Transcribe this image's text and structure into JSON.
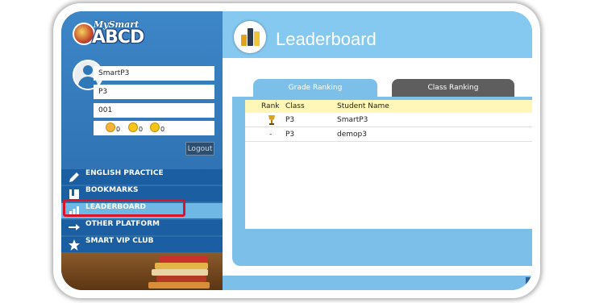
{
  "brand": {
    "top": "MySmart",
    "main": "ABCD"
  },
  "user": {
    "name": "SmartP3",
    "class": "P3",
    "number": "001"
  },
  "emoji_counts": [
    "0",
    "0",
    "0"
  ],
  "logout_label": "Logout",
  "menu": [
    {
      "label": "ENGLISH PRACTICE",
      "icon": "pencil-icon"
    },
    {
      "label": "BOOKMARKS",
      "icon": "bookmark-icon"
    },
    {
      "label": "LEADERBOARD",
      "icon": "bar-chart-icon",
      "active": true
    },
    {
      "label": "OTHER PLATFORM",
      "icon": "arrows-icon"
    },
    {
      "label": "SMART VIP CLUB",
      "icon": "star-icon"
    }
  ],
  "page": {
    "title": "Leaderboard"
  },
  "tabs": [
    {
      "label": "Grade Ranking",
      "active": true
    },
    {
      "label": "Class Ranking",
      "active": false
    }
  ],
  "table": {
    "headers": {
      "rank": "Rank",
      "class": "Class",
      "name": "Student Name"
    },
    "rows": [
      {
        "rank": "",
        "rank_icon": "trophy-icon",
        "class": "P3",
        "name": "SmartP3"
      },
      {
        "rank": "-",
        "class": "P3",
        "name": "demop3"
      }
    ]
  },
  "colors": {
    "accent": "#7cc0ea",
    "sidebar": "#1b5ea1",
    "highlight": "#d8142a",
    "header_row": "#fff7b8"
  }
}
